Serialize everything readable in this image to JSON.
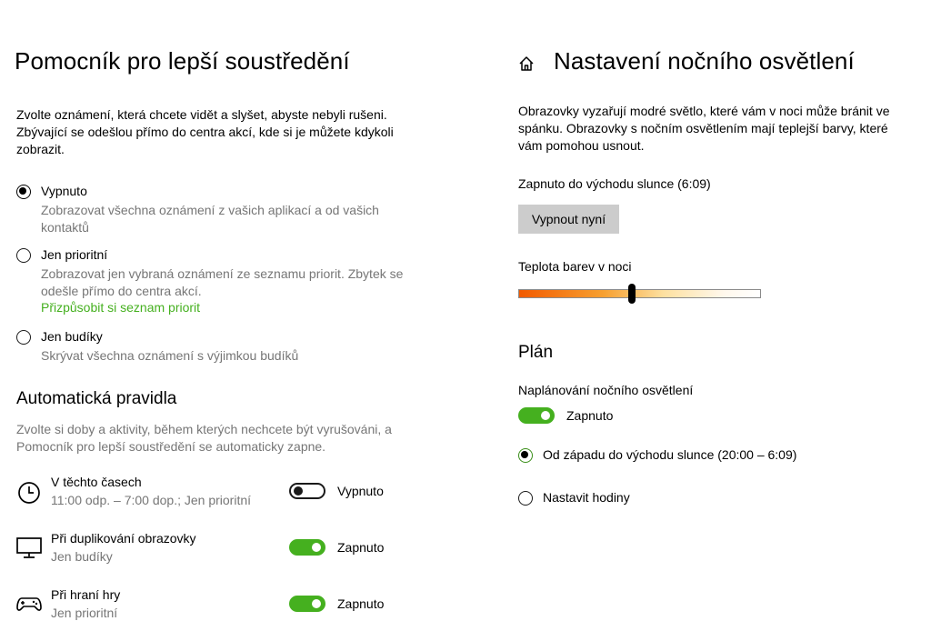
{
  "focus_assist": {
    "title": "Pomocník pro lepší soustředění",
    "intro": "Zvolte oznámení, která chcete vidět a slyšet, abyste nebyli rušeni. Zbývající se odešlou přímo do centra akcí, kde si je můžete kdykoli zobrazit.",
    "options": [
      {
        "label": "Vypnuto",
        "desc": "Zobrazovat všechna oznámení z vašich aplikací a od vašich kontaktů",
        "selected": true
      },
      {
        "label": "Jen prioritní",
        "desc": "Zobrazovat jen vybraná oznámení ze seznamu priorit. Zbytek se odešle přímo do centra akcí.",
        "link": "Přizpůsobit si seznam priorit",
        "selected": false
      },
      {
        "label": "Jen budíky",
        "desc": "Skrývat všechna oznámení s výjimkou budíků",
        "selected": false
      }
    ],
    "auto_rules": {
      "heading": "Automatická pravidla",
      "desc": "Zvolte si doby a aktivity, během kterých nechcete být vyrušováni, a Pomocník pro lepší soustředění se automaticky zapne.",
      "rules": [
        {
          "title": "V těchto časech",
          "subtitle": "11:00 odp. – 7:00 dop.; Jen prioritní",
          "icon": "clock-icon",
          "state": "Vypnuto",
          "on": false
        },
        {
          "title": "Při duplikování obrazovky",
          "subtitle": "Jen budíky",
          "icon": "monitor-icon",
          "state": "Zapnuto",
          "on": true
        },
        {
          "title": "Při hraní hry",
          "subtitle": "Jen prioritní",
          "icon": "gamepad-icon",
          "state": "Zapnuto",
          "on": true
        }
      ]
    }
  },
  "night_light": {
    "home_icon": "home-icon",
    "title": "Nastavení nočního osvětlení",
    "intro": "Obrazovky vyzařují modré světlo, které vám v noci může bránit ve spánku. Obrazovky s nočním osvětlením mají teplejší barvy, které vám pomohou usnout.",
    "status": "Zapnuto do východu slunce (6:09)",
    "button": "Vypnout nyní",
    "temperature_label": "Teplota barev v noci",
    "temperature_value": 0.47,
    "schedule": {
      "heading": "Plán",
      "label": "Naplánování nočního osvětlení",
      "toggle_state": "Zapnuto",
      "toggle_on": true,
      "options": [
        {
          "label": "Od západu do východu slunce (20:00 – 6:09)",
          "selected": true
        },
        {
          "label": "Nastavit hodiny",
          "selected": false
        }
      ]
    }
  },
  "colors": {
    "accent": "#45b01f",
    "muted": "#767676"
  }
}
